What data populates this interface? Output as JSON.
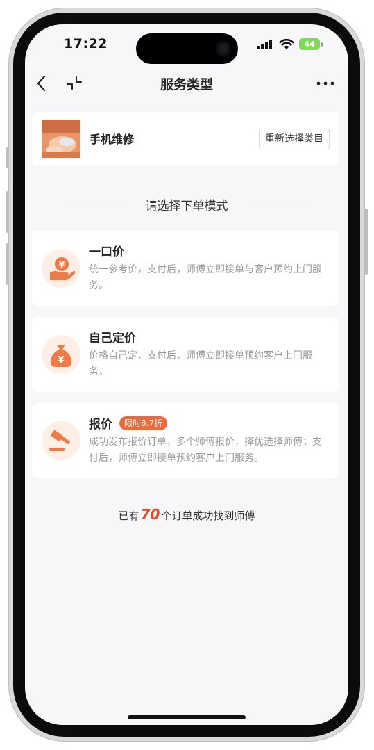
{
  "status_bar": {
    "time": "17:22",
    "battery": "44"
  },
  "nav": {
    "title": "服务类型"
  },
  "service": {
    "name": "手机维修",
    "reselect_label": "重新选择类目"
  },
  "section": {
    "title": "请选择下单模式"
  },
  "modes": [
    {
      "title": "一口价",
      "desc": "统一参考价，支付后，师傅立即接单与客户预约上门服务。",
      "icon": "yen-hand-icon"
    },
    {
      "title": "自己定价",
      "desc": "价格自己定，支付后，师傅立即接单预约客户上门服务。",
      "icon": "money-bag-icon"
    },
    {
      "title": "报价",
      "badge": "限时8.7折",
      "desc": "成功发布报价订单，多个师傅报价，择优选择师傅；支付后，师傅立即接单预约客户上门服务。",
      "icon": "gavel-icon"
    }
  ],
  "stats": {
    "prefix": "已有",
    "count": "70",
    "suffix": "个订单成功找到师傅"
  },
  "colors": {
    "accent": "#ef6a3a",
    "icon_bg": "#fdeee6",
    "count": "#e5482a"
  }
}
